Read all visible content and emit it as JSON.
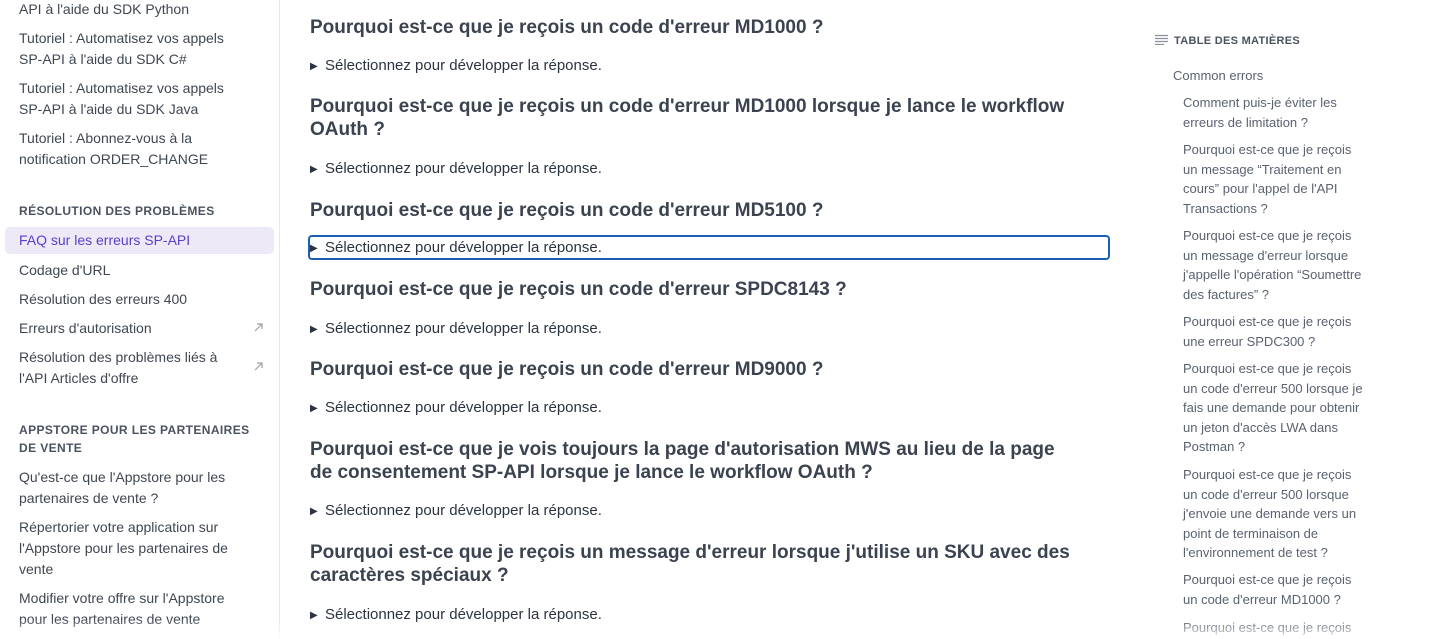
{
  "sidebar": {
    "top_links": [
      "API à l'aide du SDK Python",
      "Tutoriel : Automatisez vos appels SP-API à l'aide du SDK C#",
      "Tutoriel : Automatisez vos appels SP-API à l'aide du SDK Java",
      "Tutoriel : Abonnez-vous à la notification ORDER_CHANGE"
    ],
    "section_troubleshooting": "RÉSOLUTION DES PROBLÈMES",
    "active_item": "FAQ sur les erreurs SP-API",
    "troubleshooting_links": [
      "Codage d'URL",
      "Résolution des erreurs 400",
      "Erreurs d'autorisation",
      "Résolution des problèmes liés à l'API Articles d'offre"
    ],
    "section_appstore": "APPSTORE POUR LES PARTENAIRES DE VENTE",
    "appstore_links": [
      "Qu'est-ce que l'Appstore pour les partenaires de vente ?",
      "Répertorier votre application sur l'Appstore pour les partenaires de vente",
      "Modifier votre offre sur l'Appstore pour les partenaires de vente"
    ]
  },
  "main": {
    "expand_label": "Sélectionnez pour développer la réponse.",
    "questions": [
      "Pourquoi est-ce que je reçois un code d'erreur MD1000 ?",
      "Pourquoi est-ce que je reçois un code d'erreur MD1000 lorsque je lance le workflow OAuth ?",
      "Pourquoi est-ce que je reçois un code d'erreur MD5100 ?",
      "Pourquoi est-ce que je reçois un code d'erreur SPDC8143 ?",
      "Pourquoi est-ce que je reçois un code d'erreur MD9000 ?",
      "Pourquoi est-ce que je vois toujours la page d'autorisation MWS au lieu de la page de consentement SP-API lorsque je lance le workflow OAuth ?",
      "Pourquoi est-ce que je reçois un message d'erreur lorsque j'utilise un SKU avec des caractères spéciaux ?"
    ]
  },
  "toc": {
    "header": "TABLE DES MATIÈRES",
    "top": "Common errors",
    "items": [
      "Comment puis-je éviter les erreurs de limitation ?",
      "Pourquoi est-ce que je reçois un message “Traitement en cours” pour l'appel de l'API Transactions ?",
      "Pourquoi est-ce que je reçois un message d'erreur lorsque j'appelle l'opération “Soumettre des factures” ?",
      "Pourquoi est-ce que je reçois une erreur SPDC300 ?",
      "Pourquoi est-ce que je reçois un code d'erreur 500 lorsque je fais une demande pour obtenir un jeton d'accès LWA dans Postman ?",
      "Pourquoi est-ce que je reçois un code d'erreur 500 lorsque j'envoie une demande vers un point de terminaison de l'environnement de test ?",
      "Pourquoi est-ce que je reçois un code d'erreur MD1000 ?",
      "Pourquoi est-ce que je reçois"
    ]
  },
  "icons": {
    "external": "external-link-icon",
    "toggle": "triangle-right-icon",
    "toc": "list-lines-icon"
  },
  "colors": {
    "accent": "#5b3fc4",
    "active_bg": "#ede9f7",
    "focus": "#1a5fb4"
  }
}
